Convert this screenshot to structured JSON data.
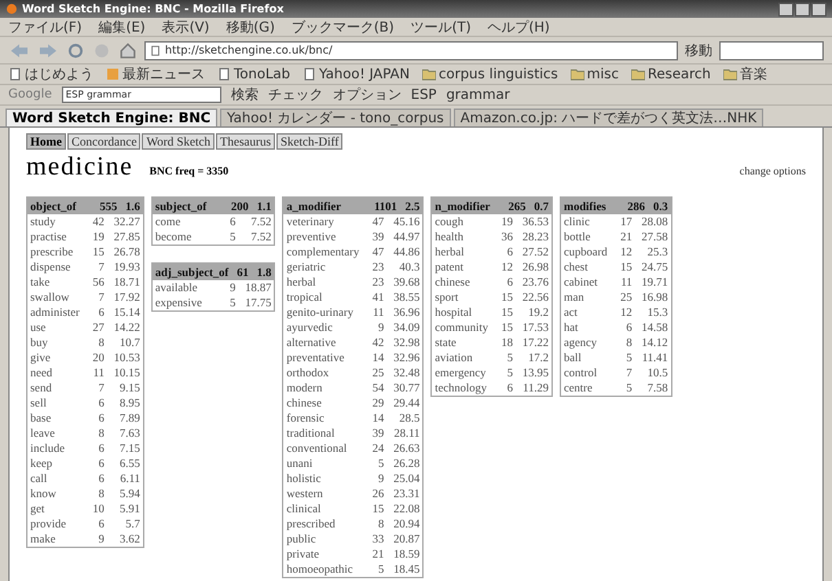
{
  "window": {
    "title": "Word Sketch Engine: BNC - Mozilla Firefox"
  },
  "menu": [
    "ファイル(F)",
    "編集(E)",
    "表示(V)",
    "移動(G)",
    "ブックマーク(B)",
    "ツール(T)",
    "ヘルプ(H)"
  ],
  "navbar": {
    "url": "http://sketchengine.co.uk/bnc/",
    "go": "移動"
  },
  "bookmarks": [
    {
      "label": "はじめよう",
      "kind": "page"
    },
    {
      "label": "最新ニュース",
      "kind": "feed"
    },
    {
      "label": "TonoLab",
      "kind": "page"
    },
    {
      "label": "Yahoo! JAPAN",
      "kind": "page"
    },
    {
      "label": "corpus linguistics",
      "kind": "folder"
    },
    {
      "label": "misc",
      "kind": "folder"
    },
    {
      "label": "Research",
      "kind": "folder"
    },
    {
      "label": "音楽",
      "kind": "folder"
    }
  ],
  "google_bar": {
    "logo": "Google",
    "query": "ESP grammar",
    "buttons": [
      "検索",
      "チェック",
      "オプション",
      "ESP",
      "grammar"
    ]
  },
  "tabs": [
    {
      "label": "Word Sketch Engine: BNC",
      "selected": true
    },
    {
      "label": "Yahoo! カレンダー - tono_corpus",
      "selected": false
    },
    {
      "label": "Amazon.co.jp: ハードで差がつく英文法…NHK",
      "selected": false
    }
  ],
  "page_nav": [
    {
      "label": "Home",
      "selected": true
    },
    {
      "label": "Concordance",
      "selected": false
    },
    {
      "label": "Word Sketch",
      "selected": false
    },
    {
      "label": "Thesaurus",
      "selected": false
    },
    {
      "label": "Sketch-Diff",
      "selected": false
    }
  ],
  "lemma": "medicine",
  "freq": "BNC freq = 3350",
  "change_options": "change options",
  "columns": [
    [
      {
        "relation": "object_of",
        "count": "555",
        "score": "1.6",
        "rows": [
          {
            "word": "study",
            "count": "42",
            "score": "32.27"
          },
          {
            "word": "practise",
            "count": "19",
            "score": "27.85"
          },
          {
            "word": "prescribe",
            "count": "15",
            "score": "26.78"
          },
          {
            "word": "dispense",
            "count": "7",
            "score": "19.93"
          },
          {
            "word": "take",
            "count": "56",
            "score": "18.71"
          },
          {
            "word": "swallow",
            "count": "7",
            "score": "17.92"
          },
          {
            "word": "administer",
            "count": "6",
            "score": "15.14"
          },
          {
            "word": "use",
            "count": "27",
            "score": "14.22"
          },
          {
            "word": "buy",
            "count": "8",
            "score": "10.7"
          },
          {
            "word": "give",
            "count": "20",
            "score": "10.53"
          },
          {
            "word": "need",
            "count": "11",
            "score": "10.15"
          },
          {
            "word": "send",
            "count": "7",
            "score": "9.15"
          },
          {
            "word": "sell",
            "count": "6",
            "score": "8.95"
          },
          {
            "word": "base",
            "count": "6",
            "score": "7.89"
          },
          {
            "word": "leave",
            "count": "8",
            "score": "7.63"
          },
          {
            "word": "include",
            "count": "6",
            "score": "7.15"
          },
          {
            "word": "keep",
            "count": "6",
            "score": "6.55"
          },
          {
            "word": "call",
            "count": "6",
            "score": "6.11"
          },
          {
            "word": "know",
            "count": "8",
            "score": "5.94"
          },
          {
            "word": "get",
            "count": "10",
            "score": "5.91"
          },
          {
            "word": "provide",
            "count": "6",
            "score": "5.7"
          },
          {
            "word": "make",
            "count": "9",
            "score": "3.62"
          }
        ]
      }
    ],
    [
      {
        "relation": "subject_of",
        "count": "200",
        "score": "1.1",
        "rows": [
          {
            "word": "come",
            "count": "6",
            "score": "7.52"
          },
          {
            "word": "become",
            "count": "5",
            "score": "7.52"
          }
        ]
      },
      {
        "relation": "adj_subject_of",
        "count": "61",
        "score": "1.8",
        "rows": [
          {
            "word": "available",
            "count": "9",
            "score": "18.87"
          },
          {
            "word": "expensive",
            "count": "5",
            "score": "17.75"
          }
        ]
      }
    ],
    [
      {
        "relation": "a_modifier",
        "count": "1101",
        "score": "2.5",
        "rows": [
          {
            "word": "veterinary",
            "count": "47",
            "score": "45.16"
          },
          {
            "word": "preventive",
            "count": "39",
            "score": "44.97"
          },
          {
            "word": "complementary",
            "count": "47",
            "score": "44.86"
          },
          {
            "word": "geriatric",
            "count": "23",
            "score": "40.3"
          },
          {
            "word": "herbal",
            "count": "23",
            "score": "39.68"
          },
          {
            "word": "tropical",
            "count": "41",
            "score": "38.55"
          },
          {
            "word": "genito-urinary",
            "count": "11",
            "score": "36.96"
          },
          {
            "word": "ayurvedic",
            "count": "9",
            "score": "34.09"
          },
          {
            "word": "alternative",
            "count": "42",
            "score": "32.98"
          },
          {
            "word": "preventative",
            "count": "14",
            "score": "32.96"
          },
          {
            "word": "orthodox",
            "count": "25",
            "score": "32.48"
          },
          {
            "word": "modern",
            "count": "54",
            "score": "30.77"
          },
          {
            "word": "chinese",
            "count": "29",
            "score": "29.44"
          },
          {
            "word": "forensic",
            "count": "14",
            "score": "28.5"
          },
          {
            "word": "traditional",
            "count": "39",
            "score": "28.11"
          },
          {
            "word": "conventional",
            "count": "24",
            "score": "26.63"
          },
          {
            "word": "unani",
            "count": "5",
            "score": "26.28"
          },
          {
            "word": "holistic",
            "count": "9",
            "score": "25.04"
          },
          {
            "word": "western",
            "count": "26",
            "score": "23.31"
          },
          {
            "word": "clinical",
            "count": "15",
            "score": "22.08"
          },
          {
            "word": "prescribed",
            "count": "8",
            "score": "20.94"
          },
          {
            "word": "public",
            "count": "33",
            "score": "20.87"
          },
          {
            "word": "private",
            "count": "21",
            "score": "18.59"
          },
          {
            "word": "homoeopathic",
            "count": "5",
            "score": "18.45"
          }
        ]
      }
    ],
    [
      {
        "relation": "n_modifier",
        "count": "265",
        "score": "0.7",
        "rows": [
          {
            "word": "cough",
            "count": "19",
            "score": "36.53"
          },
          {
            "word": "health",
            "count": "36",
            "score": "28.23"
          },
          {
            "word": "herbal",
            "count": "6",
            "score": "27.52"
          },
          {
            "word": "patent",
            "count": "12",
            "score": "26.98"
          },
          {
            "word": "chinese",
            "count": "6",
            "score": "23.76"
          },
          {
            "word": "sport",
            "count": "15",
            "score": "22.56"
          },
          {
            "word": "hospital",
            "count": "15",
            "score": "19.2"
          },
          {
            "word": "community",
            "count": "15",
            "score": "17.53"
          },
          {
            "word": "state",
            "count": "18",
            "score": "17.22"
          },
          {
            "word": "aviation",
            "count": "5",
            "score": "17.2"
          },
          {
            "word": "emergency",
            "count": "5",
            "score": "13.95"
          },
          {
            "word": "technology",
            "count": "6",
            "score": "11.29"
          }
        ]
      }
    ],
    [
      {
        "relation": "modifies",
        "count": "286",
        "score": "0.3",
        "rows": [
          {
            "word": "clinic",
            "count": "17",
            "score": "28.08"
          },
          {
            "word": "bottle",
            "count": "21",
            "score": "27.58"
          },
          {
            "word": "cupboard",
            "count": "12",
            "score": "25.3"
          },
          {
            "word": "chest",
            "count": "15",
            "score": "24.75"
          },
          {
            "word": "cabinet",
            "count": "11",
            "score": "19.71"
          },
          {
            "word": "man",
            "count": "25",
            "score": "16.98"
          },
          {
            "word": "act",
            "count": "12",
            "score": "15.3"
          },
          {
            "word": "hat",
            "count": "6",
            "score": "14.58"
          },
          {
            "word": "agency",
            "count": "8",
            "score": "14.12"
          },
          {
            "word": "ball",
            "count": "5",
            "score": "11.41"
          },
          {
            "word": "control",
            "count": "7",
            "score": "10.5"
          },
          {
            "word": "centre",
            "count": "5",
            "score": "7.58"
          }
        ]
      }
    ]
  ]
}
